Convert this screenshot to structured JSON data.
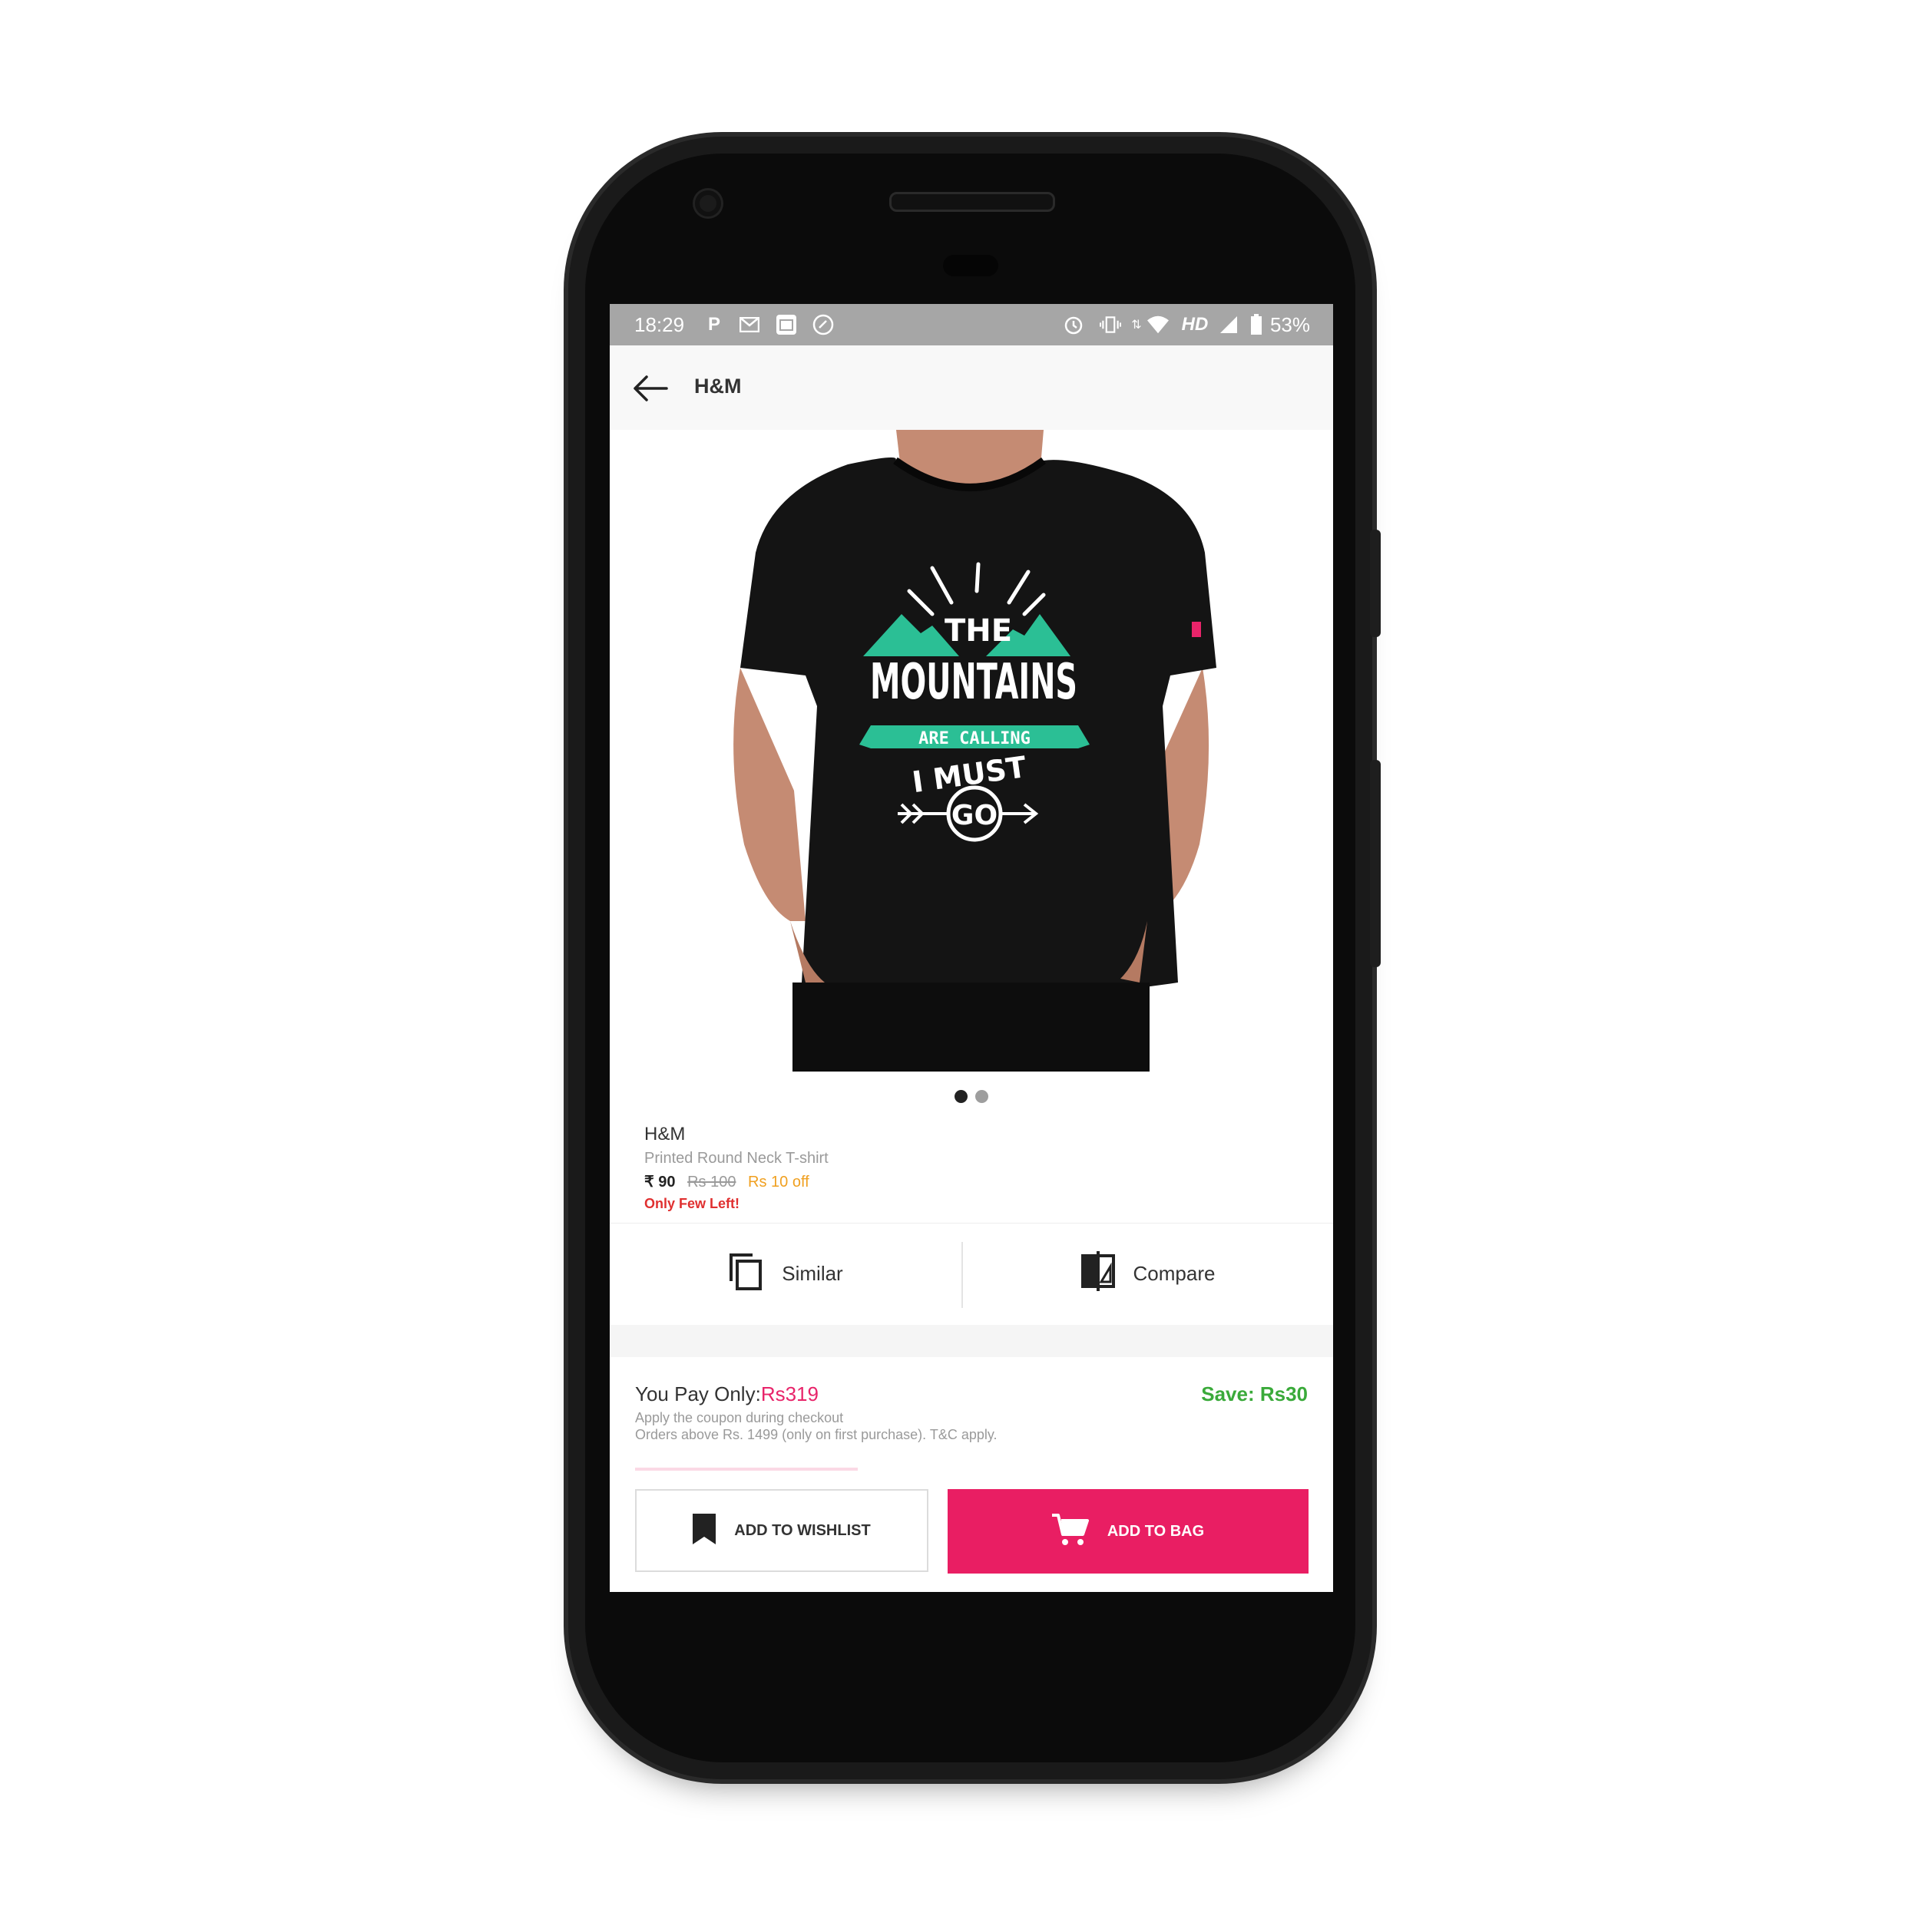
{
  "status_bar": {
    "time": "18:29",
    "battery": "53%",
    "network": "HD",
    "icons": [
      "p-app-icon",
      "gmail-icon",
      "calendar-icon",
      "sync-icon",
      "alarm-icon",
      "vibrate-icon",
      "data-arrows-icon",
      "wifi-icon",
      "signal-icon",
      "battery-icon"
    ]
  },
  "app_bar": {
    "title": "H&M",
    "back_icon": "back-arrow-icon"
  },
  "product": {
    "image_name": "tshirt-model-image",
    "print_text": [
      "THE",
      "MOUNTAINS",
      "ARE CALLING",
      "I MUST",
      "GO"
    ],
    "carousel": {
      "count": 2,
      "active": 0
    },
    "brand": "H&M",
    "name": "Printed Round Neck T-shirt",
    "price": "₹ 90",
    "mrp": "Rs 100",
    "discount": "Rs 10 off",
    "stock_note": "Only Few Left!"
  },
  "actions": {
    "similar": {
      "label": "Similar",
      "icon": "similar-icon"
    },
    "compare": {
      "label": "Compare",
      "icon": "compare-icon"
    }
  },
  "pay": {
    "label": "You Pay Only:",
    "amount": "Rs319",
    "save": "Save: Rs30",
    "note1": "Apply the coupon during checkout",
    "note2": "Orders above Rs. 1499 (only on first purchase). T&C apply."
  },
  "buttons": {
    "wishlist": {
      "label": "ADD TO WISHLIST",
      "icon": "bookmark-icon"
    },
    "bag": {
      "label": "ADD TO BAG",
      "icon": "cart-icon"
    }
  },
  "colors": {
    "accent": "#e91e63",
    "save_green": "#3aaa3a",
    "offer_orange": "#f0a020",
    "stock_red": "#e03030",
    "status_bar": "#a6a6a6",
    "print_teal": "#2bbf95"
  }
}
